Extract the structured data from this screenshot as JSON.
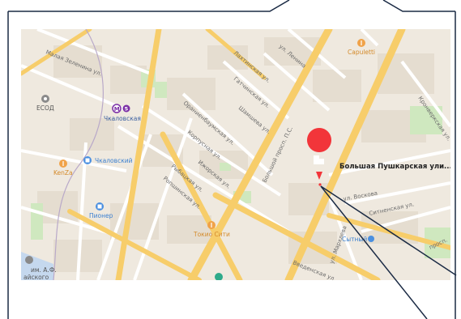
{
  "colors": {
    "accent_marker": "#f2353a",
    "poi_orange": "#f0a248",
    "poi_blue": "#4a8fe0",
    "metro_purple": "#7b2fa6",
    "road_major": "#f7cd6a"
  },
  "map": {
    "selected_place": {
      "label": "Большая Пушкарская ули...",
      "icon": "building-icon"
    },
    "street_labels": {
      "s1": "Малая Зеленина ул.",
      "s2": "ул. Ленина",
      "s3": "Лахтинская ул.",
      "s4": "Гатчинская ул.",
      "s5": "Ораниенбаумская ул.",
      "s6": "Шамшева ул.",
      "s7": "Корпусная ул.",
      "s8": "Большой просп. П.С.",
      "s9": "Ижорская ул.",
      "s10": "Ропшинская ул.",
      "s11": "Рыбацкая ул.",
      "s12": "ул. Воскова",
      "s13": "Ситненская ул.",
      "s14": "Введенская ул.",
      "s15": "ул. Мархлева",
      "s16": "Кронверкская ул.",
      "s17": "просп."
    },
    "pois": {
      "esod": "ЕСОД",
      "metro_station": "Чкаловская",
      "metro_line_number": "5",
      "cinema": "Чкаловский",
      "kenza": "KenZa",
      "pioneer": "Пионер",
      "tokyo": "Токио Сити",
      "capuletti": "Capuletti",
      "sytny": "Сытный",
      "im_af": "им. А.Ф.",
      "im_af_2": "айского"
    }
  }
}
